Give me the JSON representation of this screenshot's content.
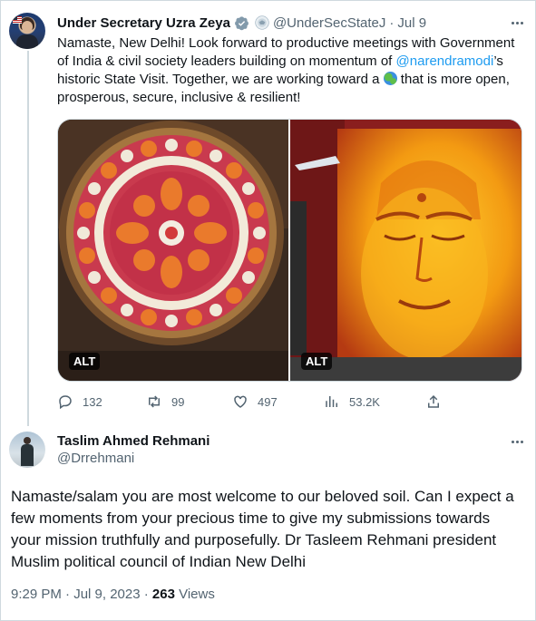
{
  "tweet1": {
    "author_name": "Under Secretary Uzra Zeya",
    "handle": "@UnderSecStateJ",
    "separator": "·",
    "date": "Jul 9",
    "text_part1": "Namaste, New Delhi! Look forward to productive meetings with Government of India & civil society leaders building on momentum of ",
    "mention": "@narendramodi",
    "text_part2": "’s historic State Visit. Together, we are working toward a ",
    "text_part3": " that is more open, prosperous, secure, inclusive & resilient!",
    "media": [
      {
        "alt_label": "ALT",
        "description_icon": "flower-rangoli-image"
      },
      {
        "alt_label": "ALT",
        "description_icon": "buddha-face-mural-image"
      }
    ],
    "stats": {
      "replies": "132",
      "retweets": "99",
      "likes": "497",
      "views": "53.2K"
    }
  },
  "tweet2": {
    "author_name": "Taslim Ahmed Rehmani",
    "handle": "@Drrehmani",
    "text": "Namaste/salam you are most welcome to our beloved soil. Can I expect a few moments from your precious time to give my submissions towards your mission truthfully and purposefully. Dr Tasleem Rehmani president Muslim political council of Indian New Delhi",
    "timestamp": "9:29 PM · Jul 9, 2023 · ",
    "views_count": "263",
    "views_label": " Views"
  },
  "colors": {
    "link": "#1d9bf0",
    "muted": "#536471",
    "text": "#0f1419",
    "verified": "#829aab"
  }
}
